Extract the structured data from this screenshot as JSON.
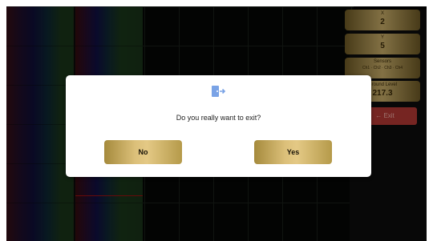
{
  "side_panel": {
    "x_box": {
      "label": "X",
      "value": "2"
    },
    "y_box": {
      "label": "Y",
      "value": "5"
    },
    "sensors_box": {
      "label": "Sensors",
      "value": "Ch1 · Ch2 · Ch3 · Ch4"
    },
    "ground_box": {
      "label": "Ground Level",
      "value": "217.3"
    },
    "exit_label": "← Exit"
  },
  "dialog": {
    "icon": "exit-door-icon",
    "message": "Do you really want to exit?",
    "no_label": "No",
    "yes_label": "Yes"
  },
  "colors": {
    "gold": "#d4b673",
    "exit_red": "#b53a35",
    "dialog_bg": "#ffffff"
  }
}
